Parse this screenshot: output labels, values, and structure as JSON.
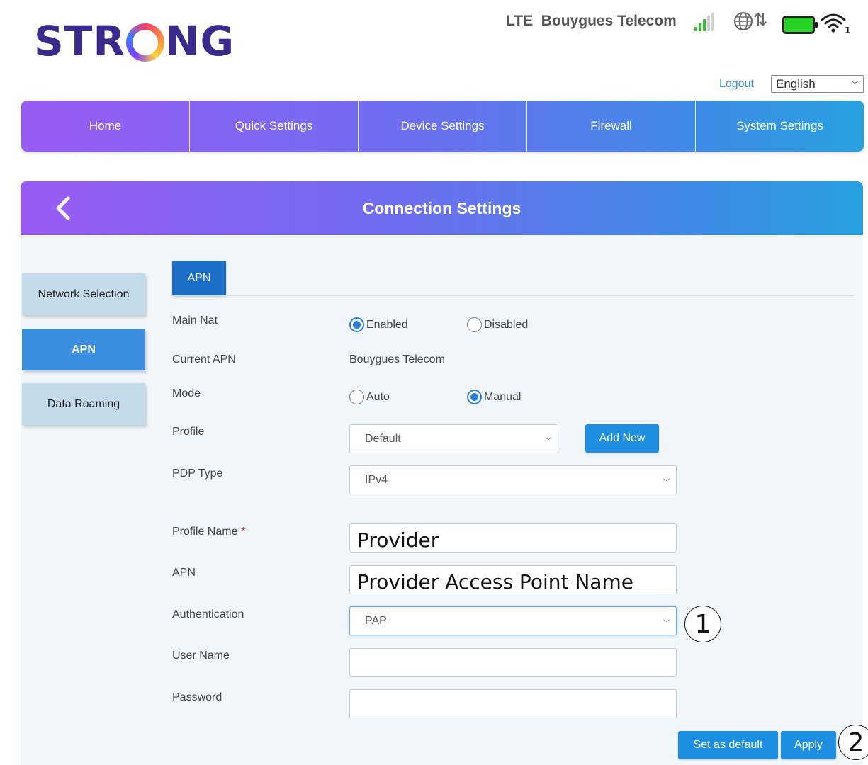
{
  "brand": {
    "logo_left": "STR",
    "logo_right": "NG"
  },
  "status": {
    "network": "LTE",
    "carrier": "Bouygues Telecom",
    "wifi_badge": "1",
    "colors": {
      "signal": "#2fbf2f",
      "battery": "#27d327"
    }
  },
  "header": {
    "logout": "Logout",
    "language": "English"
  },
  "nav": {
    "items": [
      "Home",
      "Quick Settings",
      "Device Settings",
      "Firewall",
      "System Settings"
    ]
  },
  "panel": {
    "title": "Connection Settings"
  },
  "sidebar": {
    "items": [
      "Network Selection",
      "APN",
      "Data Roaming"
    ],
    "active": "APN"
  },
  "tab": {
    "label": "APN"
  },
  "form": {
    "main_nat": {
      "label": "Main Nat",
      "enabled": "Enabled",
      "disabled": "Disabled",
      "selected": "Enabled"
    },
    "current_apn": {
      "label": "Current APN",
      "value": "Bouygues Telecom"
    },
    "mode": {
      "label": "Mode",
      "auto": "Auto",
      "manual": "Manual",
      "selected": "Manual"
    },
    "profile": {
      "label": "Profile",
      "value": "Default",
      "add_new": "Add New"
    },
    "pdp_type": {
      "label": "PDP Type",
      "value": "IPv4"
    },
    "profile_name": {
      "label": "Profile Name",
      "required_mark": "*",
      "value": "Provider"
    },
    "apn": {
      "label": "APN",
      "value": "Provider Access Point Name"
    },
    "authentication": {
      "label": "Authentication",
      "value": "PAP"
    },
    "user_name": {
      "label": "User Name",
      "value": ""
    },
    "password": {
      "label": "Password",
      "value": ""
    }
  },
  "actions": {
    "set_default": "Set as default",
    "apply": "Apply"
  },
  "callouts": [
    "1",
    "2"
  ],
  "colors": {
    "accent": "#1e8fe0",
    "gradient_start": "#9a5bf3",
    "gradient_end": "#27a0e0",
    "panel_bg": "#f1f6fb",
    "sidebar_bg": "#c3dbea"
  }
}
